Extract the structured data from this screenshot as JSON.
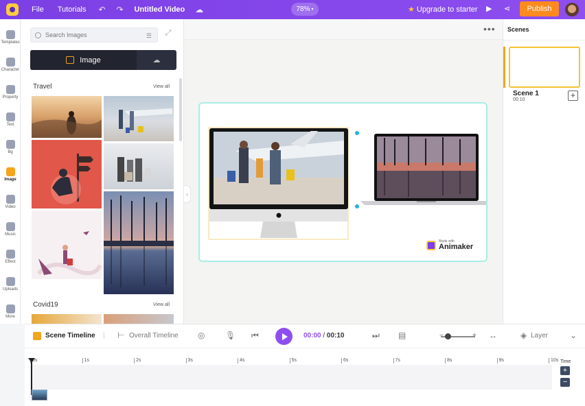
{
  "topbar": {
    "file": "File",
    "tutorials": "Tutorials",
    "undo_icon": "undo-icon",
    "redo_icon": "redo-icon",
    "title": "Untitled Video",
    "zoom": "78%",
    "upgrade": "Upgrade to starter",
    "publish": "Publish",
    "colors": {
      "bar": "#7b3fe4",
      "publish": "#ff8a1e"
    }
  },
  "rail": [
    {
      "label": "Templates",
      "icon": "templates-icon"
    },
    {
      "label": "Character",
      "icon": "character-icon"
    },
    {
      "label": "Property",
      "icon": "property-icon"
    },
    {
      "label": "Text",
      "icon": "text-icon"
    },
    {
      "label": "Bg",
      "icon": "background-icon"
    },
    {
      "label": "Image",
      "icon": "image-icon",
      "active": true
    },
    {
      "label": "Video",
      "icon": "video-icon"
    },
    {
      "label": "Music",
      "icon": "music-icon"
    },
    {
      "label": "Effect",
      "icon": "effect-icon"
    },
    {
      "label": "Uploads",
      "icon": "uploads-icon"
    },
    {
      "label": "More",
      "icon": "more-icon"
    }
  ],
  "panel": {
    "search_placeholder": "Search Images",
    "tab_image": "Image",
    "section1": "Travel",
    "section2": "Covid19",
    "view_all": "View all"
  },
  "canvas": {
    "watermark_small": "Made with",
    "watermark_brand": "Animaker"
  },
  "scenes": {
    "title": "Scenes",
    "scene_name": "Scene 1",
    "scene_duration": "00:10"
  },
  "timeline": {
    "scene_timeline": "Scene Timeline",
    "overall_timeline": "Overall Timeline",
    "current_time": "00:00",
    "total_time": "00:10",
    "layer": "Layer",
    "time_label": "Time",
    "ruler": [
      "0s",
      "1s",
      "2s",
      "3s",
      "4s",
      "5s",
      "6s",
      "7s",
      "8s",
      "9s",
      "10s"
    ]
  }
}
